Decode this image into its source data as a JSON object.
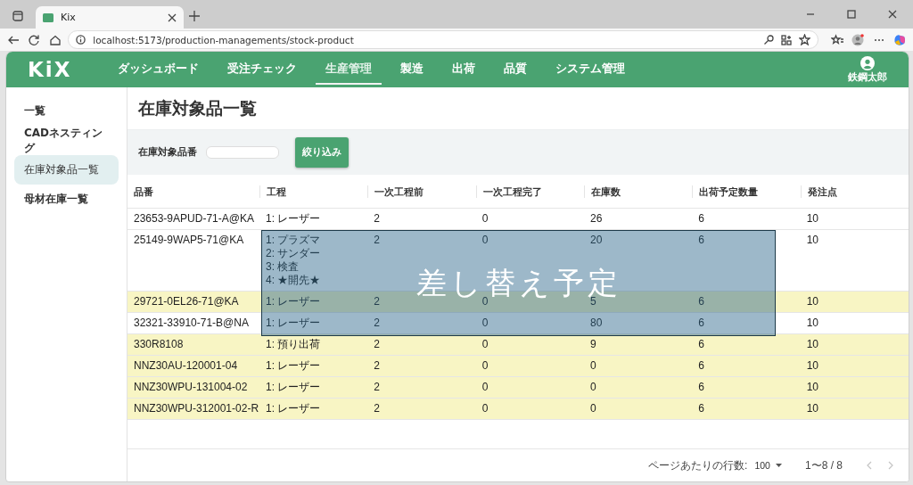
{
  "browser": {
    "tab_title": "Kix",
    "url": "localhost:5173/production-managements/stock-product"
  },
  "header": {
    "logo": "KiX",
    "nav": [
      {
        "label": "ダッシュボード",
        "selected": false
      },
      {
        "label": "受注チェック",
        "selected": false
      },
      {
        "label": "生産管理",
        "selected": true
      },
      {
        "label": "製造",
        "selected": false
      },
      {
        "label": "出荷",
        "selected": false
      },
      {
        "label": "品質",
        "selected": false
      },
      {
        "label": "システム管理",
        "selected": false
      }
    ],
    "user": "鉄鋼太郎"
  },
  "sidebar": {
    "items": [
      {
        "label": "一覧",
        "selected": false
      },
      {
        "label": "CADネスティング",
        "selected": false
      },
      {
        "label": "在庫対象品一覧",
        "selected": true
      },
      {
        "label": "母材在庫一覧",
        "selected": false
      }
    ]
  },
  "page_title": "在庫対象品一覧",
  "filter": {
    "label": "在庫対象品番",
    "button": "絞り込み"
  },
  "table": {
    "columns": [
      "品番",
      "工程",
      "一次工程前",
      "一次工程完了",
      "在庫数",
      "出荷予定数量",
      "発注点"
    ],
    "rows": [
      {
        "highlighted": false,
        "cells": [
          "23653-9APUD-71-A@KA",
          [
            "1: レーザー"
          ],
          "2",
          "0",
          "26",
          "6",
          "10"
        ]
      },
      {
        "highlighted": false,
        "cells": [
          "25149-9WAP5-71@KA",
          [
            "1: プラズマ",
            "2: サンダー",
            "3: 検査",
            "4: ★開先★"
          ],
          "2",
          "0",
          "20",
          "6",
          "10"
        ]
      },
      {
        "highlighted": true,
        "cells": [
          "29721-0EL26-71@KA",
          [
            "1: レーザー"
          ],
          "2",
          "0",
          "5",
          "6",
          "10"
        ]
      },
      {
        "highlighted": false,
        "cells": [
          "32321-33910-71-B@NA",
          [
            "1: レーザー"
          ],
          "2",
          "0",
          "80",
          "6",
          "10"
        ]
      },
      {
        "highlighted": true,
        "cells": [
          "330R8108",
          [
            "1: 預り出荷"
          ],
          "2",
          "0",
          "9",
          "6",
          "10"
        ]
      },
      {
        "highlighted": true,
        "cells": [
          "NNZ30AU-120001-04",
          [
            "1: レーザー"
          ],
          "2",
          "0",
          "0",
          "6",
          "10"
        ]
      },
      {
        "highlighted": true,
        "cells": [
          "NNZ30WPU-131004-02",
          [
            "1: レーザー"
          ],
          "2",
          "0",
          "0",
          "6",
          "10"
        ]
      },
      {
        "highlighted": true,
        "cells": [
          "NNZ30WPU-312001-02-R",
          [
            "1: レーザー"
          ],
          "2",
          "0",
          "0",
          "6",
          "10"
        ]
      }
    ]
  },
  "pagination": {
    "rows_per_page_label": "ページあたりの行数:",
    "rows_per_page": "100",
    "range": "1〜8 / 8",
    "prev": {
      "disabled": true
    },
    "next": {
      "disabled": true
    }
  },
  "overlay_note": "差し替え予定"
}
